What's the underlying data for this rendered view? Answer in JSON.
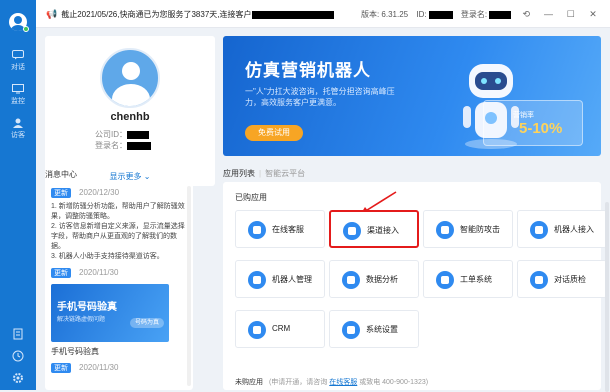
{
  "sidebar": {
    "items": [
      {
        "label": "对话",
        "icon": "chat-icon"
      },
      {
        "label": "监控",
        "icon": "monitor-icon"
      },
      {
        "label": "访客",
        "icon": "visitor-icon"
      }
    ]
  },
  "titlebar": {
    "notice": "截止2021/05/26,快商通已为您服务了3837天,连接客户",
    "version": "版本: 6.31.25",
    "id_label": "ID:",
    "login_label": "登录名:"
  },
  "profile": {
    "name": "chenhb",
    "company_label": "公司ID：",
    "login_label": "登录名：",
    "more": "显示更多"
  },
  "banner": {
    "title": "仿真营销机器人",
    "desc": "一\"人\"力扛大波咨询，托管分担咨询高峰压力，高效服务客户更满意。",
    "button": "免费试用",
    "card_label": "营销率",
    "card_value": "5-10%"
  },
  "messages": {
    "title": "消息中心",
    "items": [
      {
        "tag": "更新",
        "date": "2020/12/30",
        "text": "1. 新增防骚分析功能，帮助用户了解防骚效果，调整防骚策略。\n2. 访客信息新增自定义来源，显示流量选择字段，帮助商户从更直观的了解我们的数据。\n3. 机器人小助手支持接待渠道访客。"
      },
      {
        "tag": "更新",
        "date": "2020/11/30",
        "img_title": "手机号码验真",
        "img_sub": "解决链路虚假问题",
        "img_chip": "号码为真",
        "caption": "手机号码验真"
      },
      {
        "tag": "更新",
        "date": "2020/11/30"
      }
    ]
  },
  "apps": {
    "tab_active": "应用列表",
    "tab_inactive": "智能云平台",
    "purchased_title": "已购应用",
    "cards": [
      {
        "label": "在线客服",
        "icon": "online-service-icon"
      },
      {
        "label": "渠道接入",
        "icon": "channel-access-icon"
      },
      {
        "label": "智能防攻击",
        "icon": "shield-icon"
      },
      {
        "label": "机器人接入",
        "icon": "robot-access-icon"
      },
      {
        "label": "机器人管理",
        "icon": "robot-manage-icon"
      },
      {
        "label": "数据分析",
        "icon": "analytics-icon"
      },
      {
        "label": "工单系统",
        "icon": "ticket-icon"
      },
      {
        "label": "对话质检",
        "icon": "quality-icon"
      },
      {
        "label": "CRM",
        "icon": "crm-icon"
      },
      {
        "label": "系统设置",
        "icon": "settings-icon"
      }
    ],
    "unpurchased_title": "未购应用",
    "unpurchased_hint": "(申请开通，请咨询",
    "unpurchased_link": "在线客服",
    "unpurchased_tail": "或致电 400-900-1323)"
  }
}
